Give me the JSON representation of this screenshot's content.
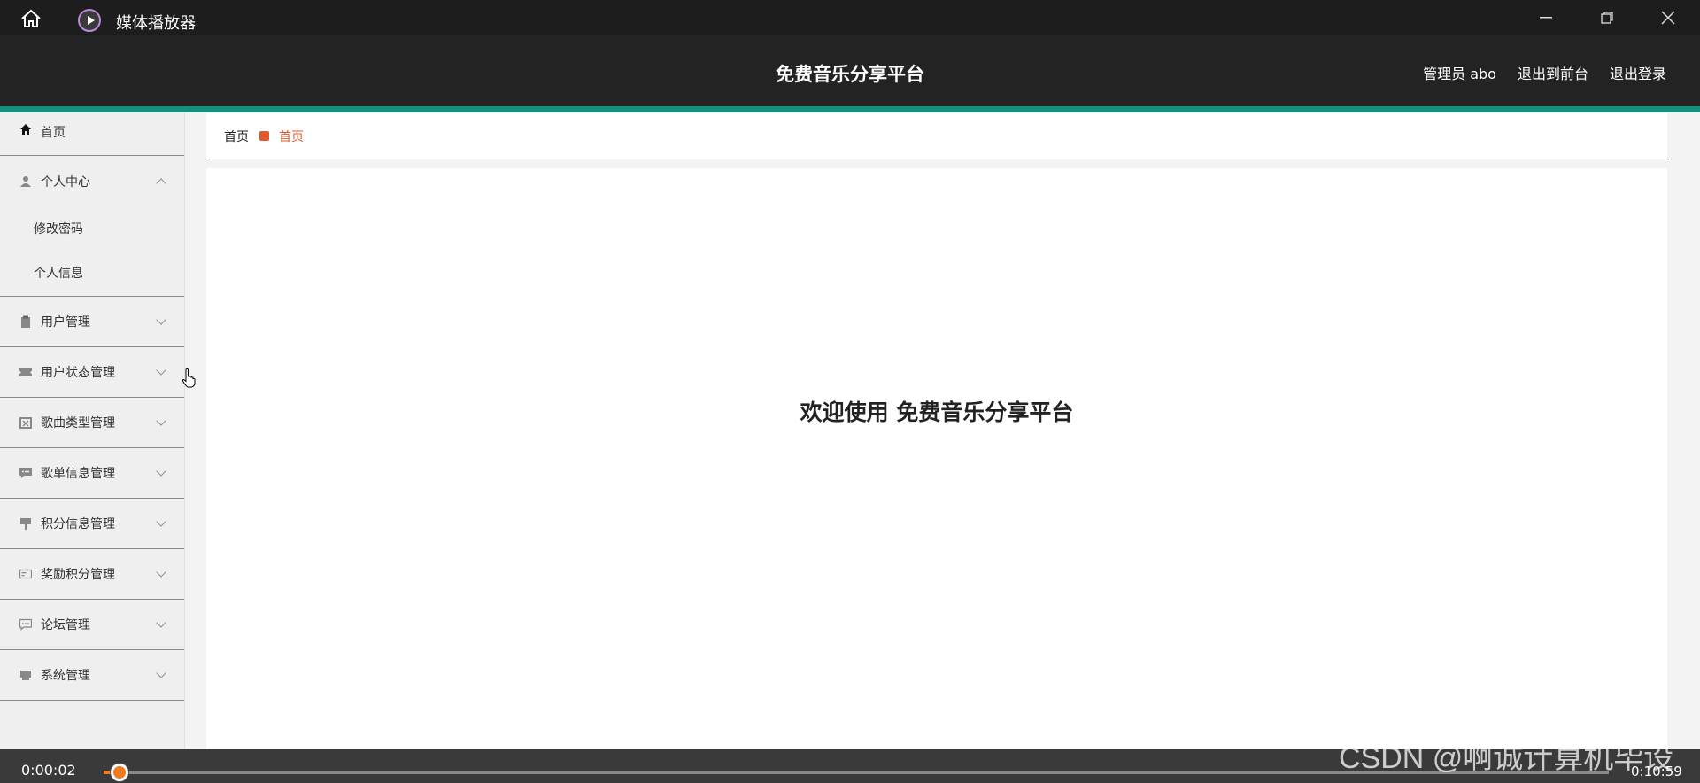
{
  "player": {
    "app_name": "媒体播放器",
    "time_current": "0:00:02",
    "time_total": "0:10:59",
    "progress": 0.003
  },
  "header": {
    "title": "免费音乐分享平台",
    "admin_label": "管理员 abo",
    "exit_front": "退出到前台",
    "logout": "退出登录"
  },
  "sidebar": {
    "home": "首页",
    "personal_center": "个人中心",
    "sub_items": [
      "修改密码",
      "个人信息"
    ],
    "items": [
      {
        "label": "用户管理",
        "icon": "clipboard-icon"
      },
      {
        "label": "用户状态管理",
        "icon": "ticket-icon"
      },
      {
        "label": "歌曲类型管理",
        "icon": "box-icon"
      },
      {
        "label": "歌单信息管理",
        "icon": "chat-icon"
      },
      {
        "label": "积分信息管理",
        "icon": "sign-icon"
      },
      {
        "label": "奖励积分管理",
        "icon": "card-icon"
      },
      {
        "label": "论坛管理",
        "icon": "message-icon"
      },
      {
        "label": "系统管理",
        "icon": "server-icon"
      }
    ]
  },
  "breadcrumb": {
    "root": "首页",
    "current": "首页"
  },
  "main": {
    "welcome": "欢迎使用 免费音乐分享平台"
  },
  "watermark": "CSDN @啊诚计算机毕设",
  "colors": {
    "accent": "#168f7d",
    "breadcrumb_current": "#e05a2e",
    "progress": "#f07b25"
  }
}
